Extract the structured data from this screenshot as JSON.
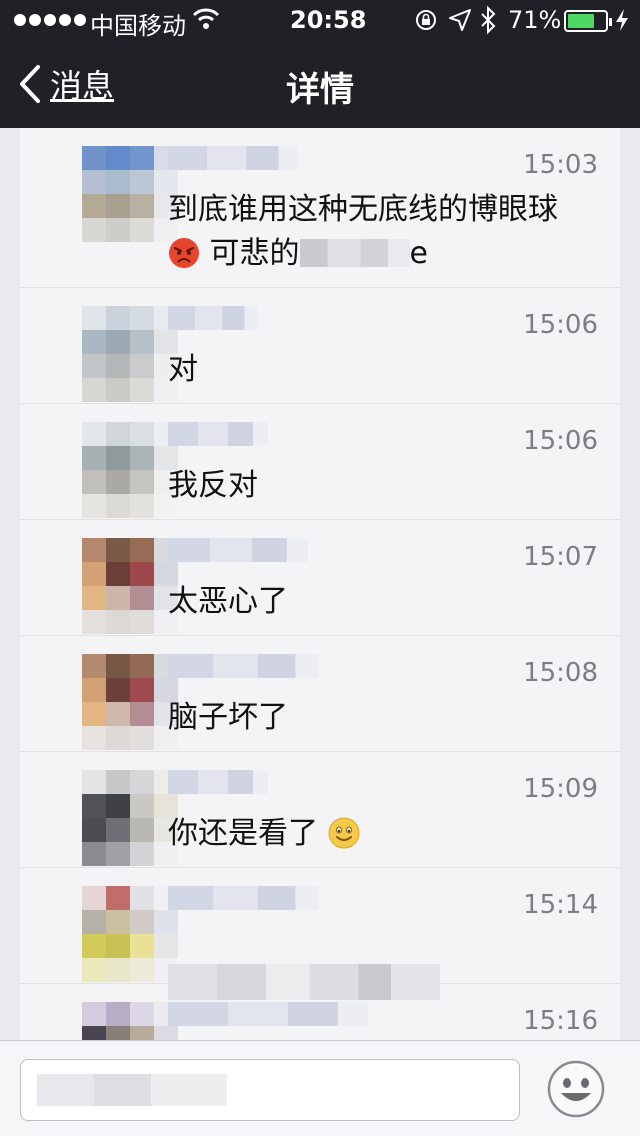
{
  "status_bar": {
    "carrier": "中国移动",
    "time": "20:58",
    "battery": "71%",
    "battery_level": 0.71
  },
  "nav": {
    "back_label": "消息",
    "title": "详情"
  },
  "messages": [
    {
      "time": "15:03",
      "text_line1": "到底谁用这种无底线的博眼球",
      "text_line2_prefix": "可悲的",
      "text_line2_suffix": "e",
      "emoji": "angry-face-icon"
    },
    {
      "time": "15:06",
      "text": "对"
    },
    {
      "time": "15:06",
      "text": "我反对"
    },
    {
      "time": "15:07",
      "text": "太恶心了"
    },
    {
      "time": "15:08",
      "text": "脑子坏了"
    },
    {
      "time": "15:09",
      "text": "你还是看了",
      "emoji": "smile-face-icon"
    },
    {
      "time": "15:14",
      "text": ""
    },
    {
      "time": "15:16",
      "text": ""
    }
  ],
  "colors": {
    "header_bg": "#1f2126",
    "battery_green": "#4cd964",
    "list_bg": "#f4f4f7"
  }
}
